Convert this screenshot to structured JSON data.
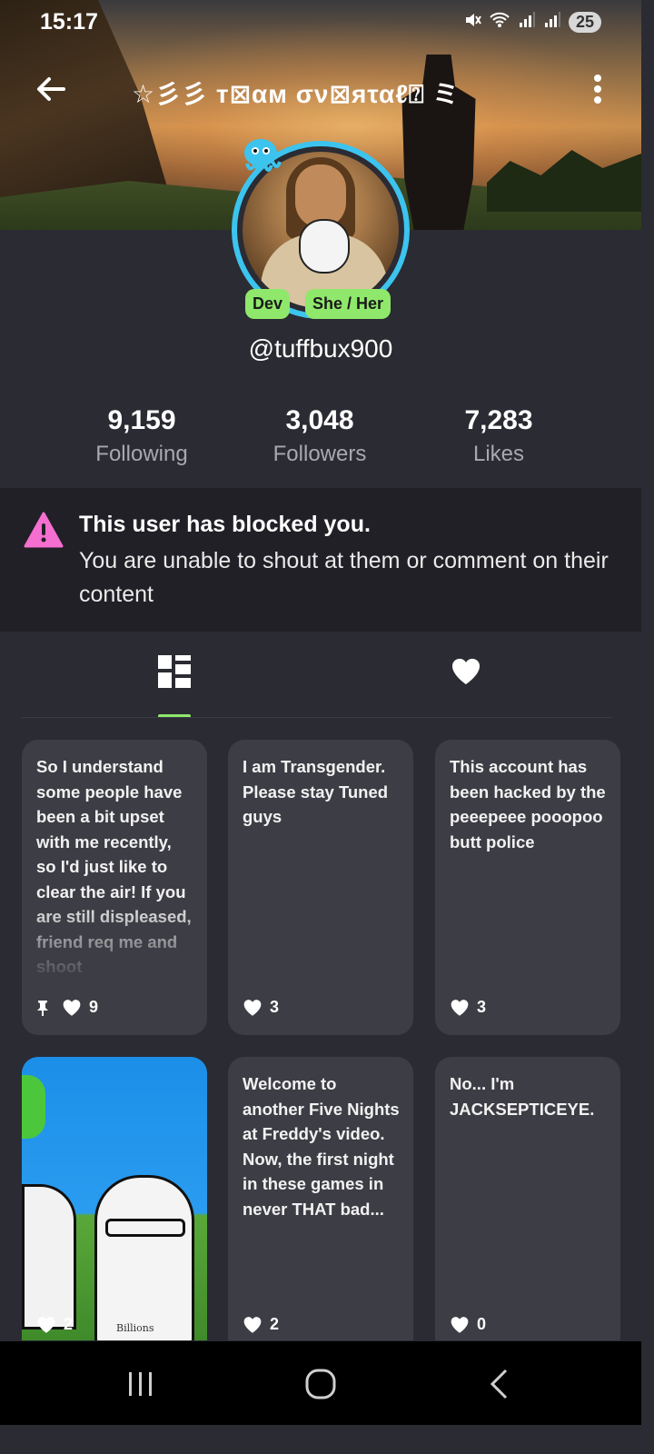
{
  "status_bar": {
    "time": "15:17",
    "battery": "25",
    "icons": [
      "mute-icon",
      "wifi-icon",
      "signal-icon",
      "signal-icon"
    ]
  },
  "header": {
    "title": "☆彡彡 т⊠αм σν⊠яταℓ⍰ ミ",
    "back_icon": "arrow-left-icon",
    "menu_icon": "more-vertical-icon"
  },
  "profile": {
    "username": "@tuffbux900",
    "badges": [
      "Dev",
      "She / Her"
    ],
    "ring_color": "#3cc4ef",
    "badge_color": "#8fe86b"
  },
  "stats": [
    {
      "value": "9,159",
      "label": "Following"
    },
    {
      "value": "3,048",
      "label": "Followers"
    },
    {
      "value": "7,283",
      "label": "Likes"
    }
  ],
  "blocked_notice": {
    "title": "This user has blocked you.",
    "message": "You are unable to shout at them or comment on their content",
    "icon": "warning-icon",
    "icon_color": "#f46fd0"
  },
  "tabs": [
    {
      "name": "posts",
      "icon": "grid-icon",
      "active": true
    },
    {
      "name": "likes",
      "icon": "heart-icon",
      "active": false
    }
  ],
  "posts": [
    {
      "text": "So I understand some people have been a bit upset with me recently, so I'd just like to clear the air! If you are still displeased, friend req me and shoot",
      "likes": "9",
      "pinned": true
    },
    {
      "text": "I am Transgender. Please stay Tuned guys",
      "likes": "3",
      "pinned": false
    },
    {
      "text": "This account has been hacked by the peeepeee pooopoo butt police",
      "likes": "3",
      "pinned": false
    },
    {
      "text": "",
      "likes": "2",
      "pinned": false,
      "image": true,
      "image_caption": "Billions"
    },
    {
      "text": "Welcome to another Five Nights at Freddy's video.\nNow, the first night in these games in never THAT bad...",
      "likes": "2",
      "pinned": false
    },
    {
      "text": "No... I'm JACKSEPTICEYE.",
      "likes": "0",
      "pinned": false
    }
  ],
  "nav_bar": {
    "buttons": [
      "recent-apps-icon",
      "home-icon",
      "back-icon"
    ]
  }
}
